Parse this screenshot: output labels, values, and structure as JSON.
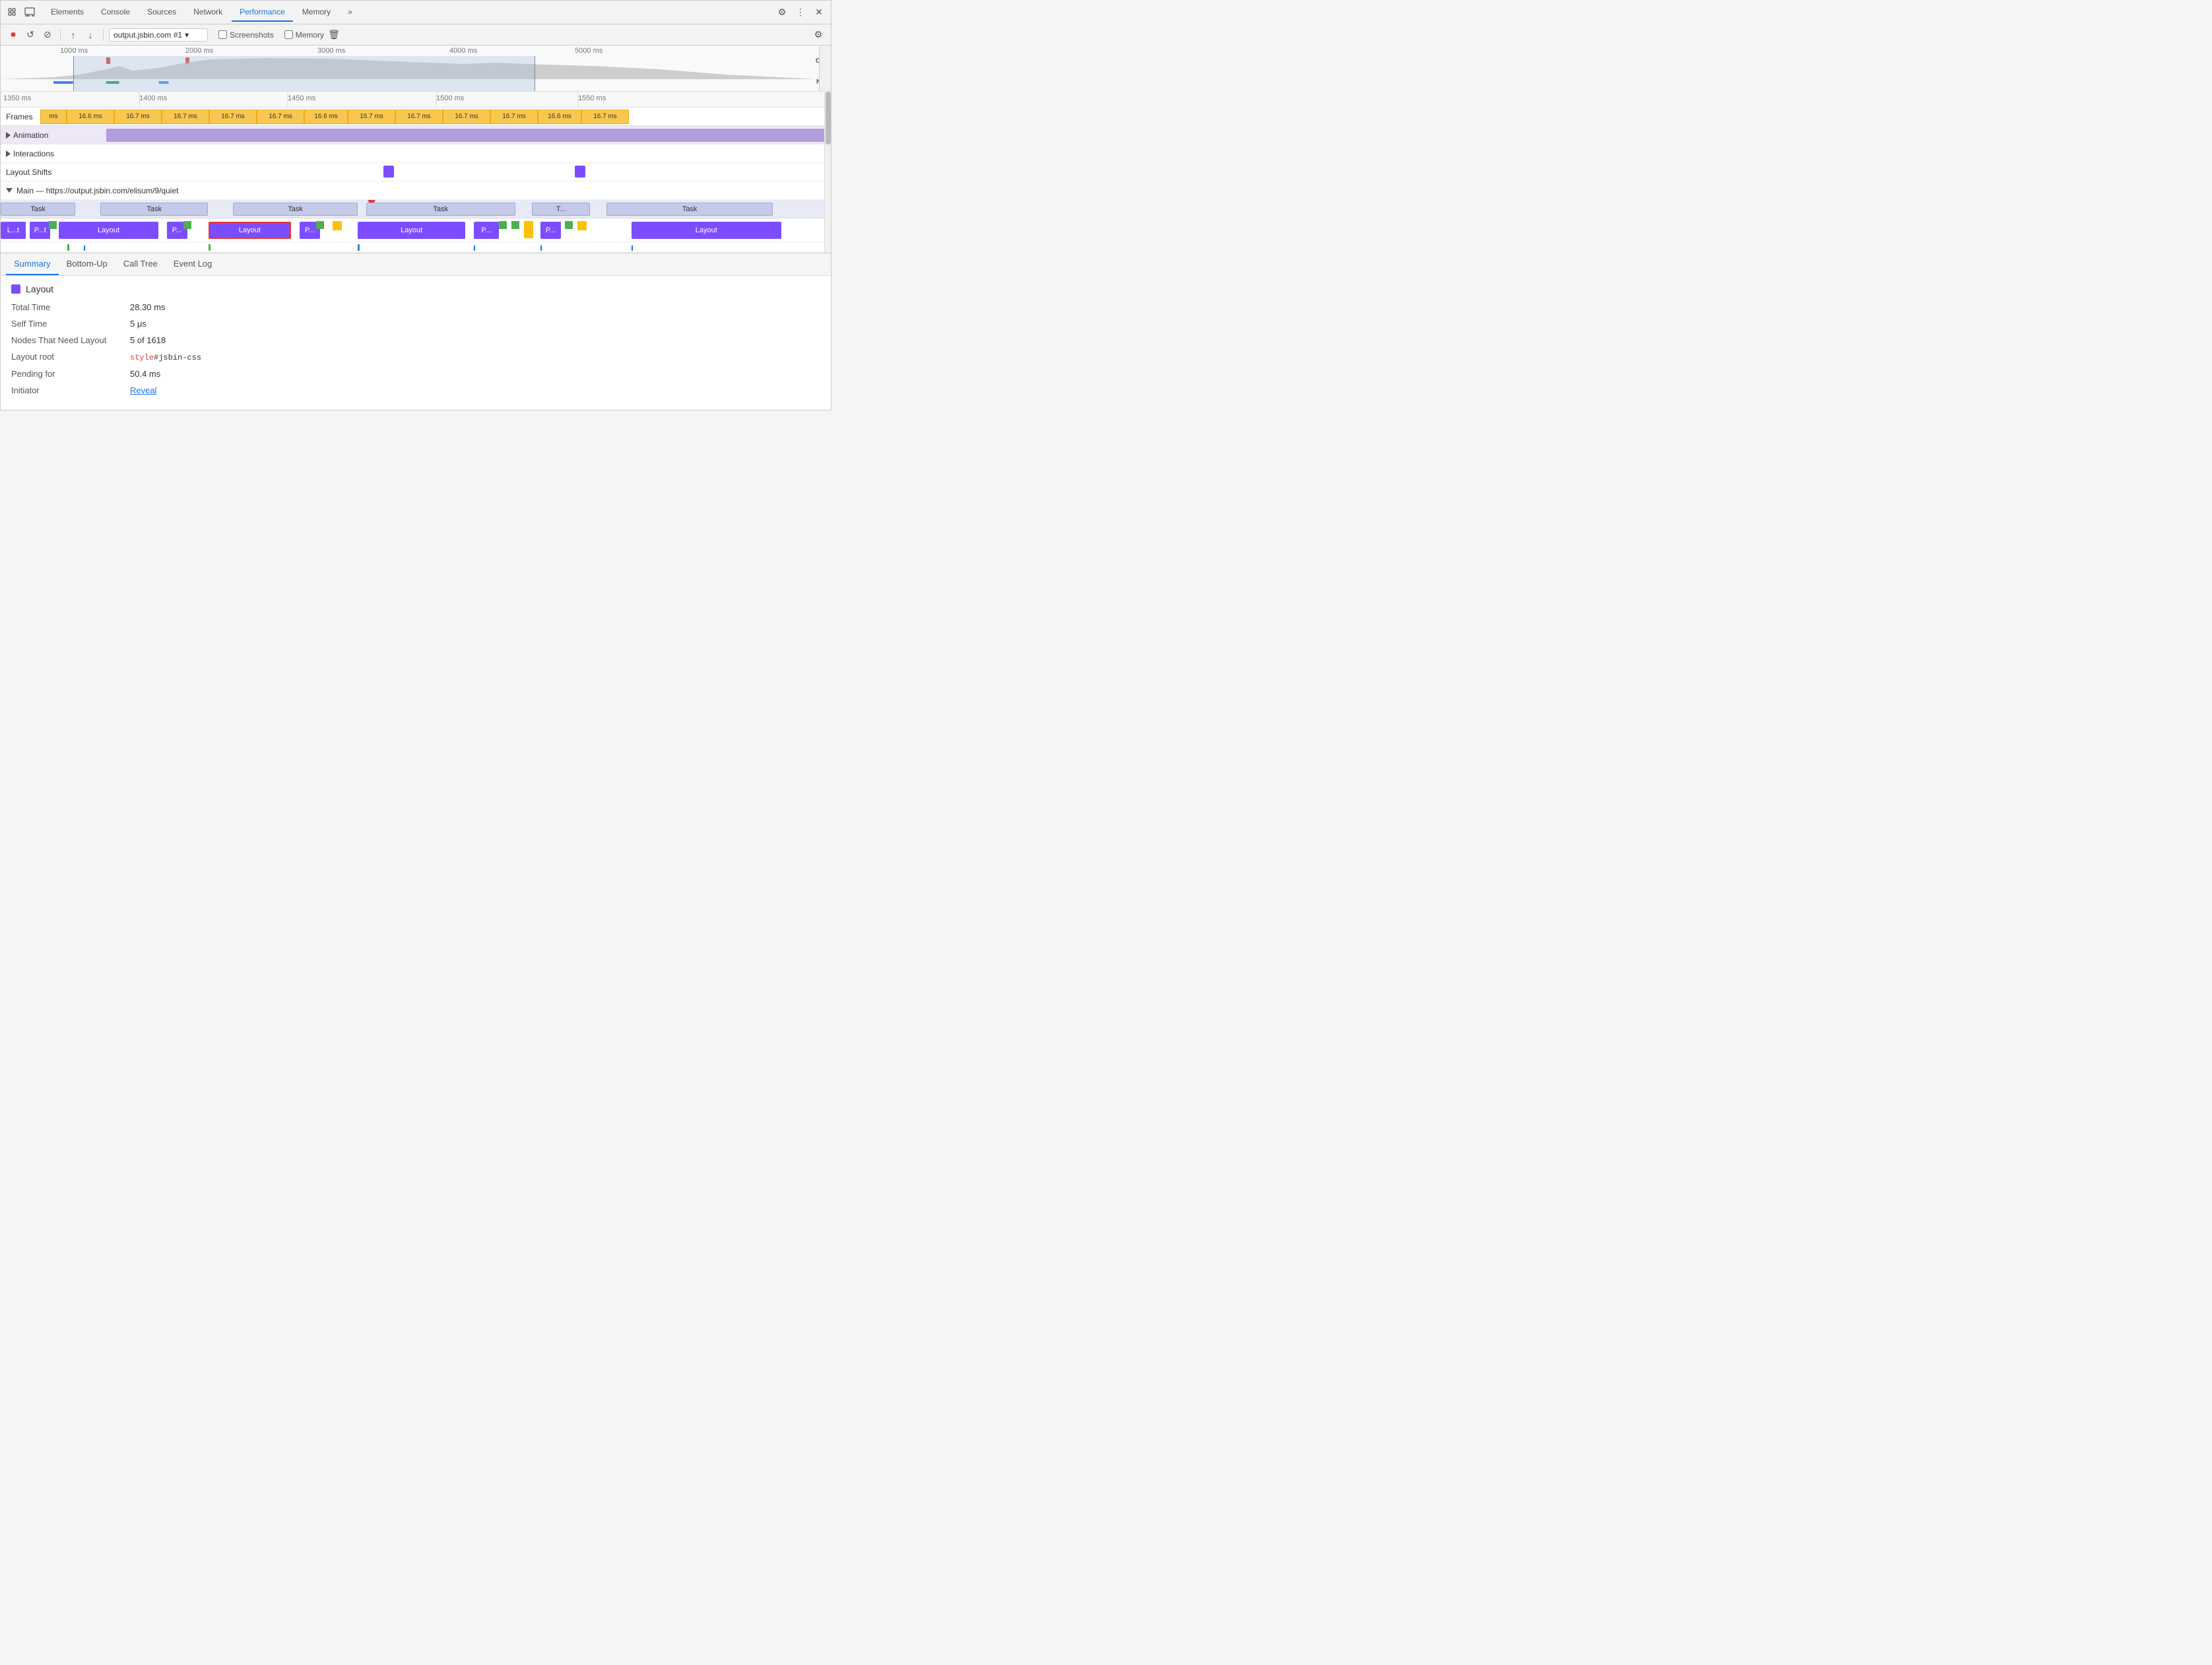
{
  "tabs": [
    {
      "label": "Elements",
      "active": false
    },
    {
      "label": "Console",
      "active": false
    },
    {
      "label": "Sources",
      "active": false
    },
    {
      "label": "Network",
      "active": false
    },
    {
      "label": "Performance",
      "active": true
    },
    {
      "label": "Memory",
      "active": false
    },
    {
      "label": "»",
      "active": false
    }
  ],
  "toolbar_icons": {
    "cursor_icon": "⊹",
    "layers_icon": "⊟",
    "settings_icon": "⚙",
    "more_icon": "⋮",
    "close_icon": "✕"
  },
  "toolbar2": {
    "record_label": "●",
    "reload_label": "↺",
    "clear_label": "⊘",
    "upload_label": "↑",
    "download_label": "↓",
    "url": "output.jsbin.com #1",
    "screenshots_label": "Screenshots",
    "memory_label": "Memory",
    "trash_label": "🗑",
    "settings_label": "⚙"
  },
  "overview": {
    "labels": [
      "1000 ms",
      "2000 ms",
      "3000 ms",
      "4000 ms",
      "5000 ms"
    ],
    "cpu_label": "CPU",
    "net_label": "NET"
  },
  "ruler": {
    "labels": [
      "1350 ms",
      "1400 ms",
      "1450 ms",
      "1500 ms",
      "1550 ms"
    ]
  },
  "frames": {
    "label": "Frames",
    "cells": [
      "ms",
      "16.6 ms",
      "16.7 ms",
      "16.7 ms",
      "16.7 ms",
      "16.7 ms",
      "16.6 ms",
      "16.7 ms",
      "16.7 ms",
      "16.7 ms",
      "16.7 ms",
      "16.6 ms",
      "16.7 ms"
    ]
  },
  "tracks": [
    {
      "label": "Animation",
      "type": "animation",
      "expanded": false
    },
    {
      "label": "Interactions",
      "type": "interactions",
      "expanded": false
    },
    {
      "label": "Layout Shifts",
      "type": "layout-shifts"
    }
  ],
  "main_section": {
    "header": "Main — https://output.jsbin.com/elisum/9/quiet",
    "tasks": [
      {
        "label": "Task",
        "left": "0%",
        "width": "10%"
      },
      {
        "label": "Task",
        "left": "12%",
        "width": "14%"
      },
      {
        "label": "Task",
        "left": "28%",
        "width": "16%"
      },
      {
        "label": "Task",
        "left": "46%",
        "width": "18%"
      },
      {
        "label": "T...",
        "left": "66%",
        "width": "8%"
      },
      {
        "label": "Task",
        "left": "76%",
        "width": "18%"
      }
    ],
    "activities": [
      {
        "label": "L...t",
        "left": "0%",
        "width": "4%",
        "color": "purple"
      },
      {
        "label": "P...t",
        "left": "4.5%",
        "width": "3%",
        "color": "purple"
      },
      {
        "label": "Layout",
        "left": "8%",
        "width": "13%",
        "color": "purple"
      },
      {
        "label": "P...",
        "left": "22%",
        "width": "3%",
        "color": "purple"
      },
      {
        "label": "Layout",
        "left": "27%",
        "width": "10%",
        "color": "purple",
        "selected": true
      },
      {
        "label": "P...",
        "left": "38%",
        "width": "3%",
        "color": "purple"
      },
      {
        "label": "Layout",
        "left": "47%",
        "width": "13%",
        "color": "purple"
      },
      {
        "label": "P...",
        "left": "61%",
        "width": "3%",
        "color": "purple"
      },
      {
        "label": "Layout",
        "left": "76%",
        "width": "18%",
        "color": "purple"
      }
    ]
  },
  "bottom_tabs": [
    {
      "label": "Summary",
      "active": true
    },
    {
      "label": "Bottom-Up",
      "active": false
    },
    {
      "label": "Call Tree",
      "active": false
    },
    {
      "label": "Event Log",
      "active": false
    }
  ],
  "summary": {
    "title": "Layout",
    "rows": [
      {
        "key": "Total Time",
        "value": "28.30 ms"
      },
      {
        "key": "Self Time",
        "value": "5 μs"
      },
      {
        "key": "Nodes That Need Layout",
        "value": "5 of 1618"
      },
      {
        "key": "Layout root",
        "value_html": true,
        "keyword": "style",
        "plain": "#jsbin-css"
      },
      {
        "key": "Pending for",
        "value": "50.4 ms"
      },
      {
        "key": "Initiator",
        "value": "Reveal",
        "is_link": true
      }
    ]
  }
}
